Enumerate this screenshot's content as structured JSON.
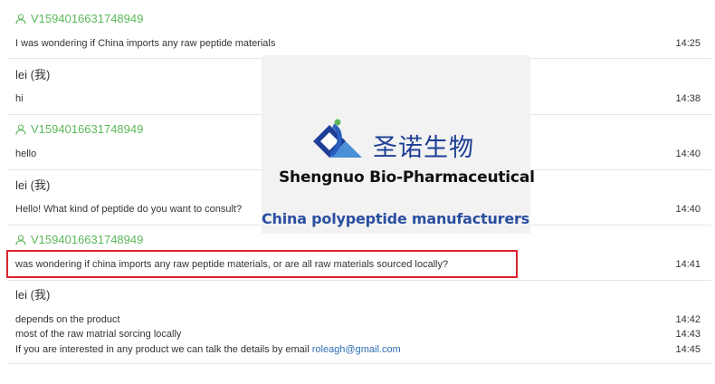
{
  "messages": [
    {
      "sender": "V1594016631748949",
      "sender_type": "visitor",
      "text": "I was wondering if China imports any raw peptide materials",
      "time": "14:25"
    },
    {
      "sender": "lei (我)",
      "sender_type": "staff",
      "text": "hi",
      "time": "14:38"
    },
    {
      "sender": "V1594016631748949",
      "sender_type": "visitor",
      "text": "hello",
      "time": "14:40"
    },
    {
      "sender": "lei (我)",
      "sender_type": "staff",
      "text": "Hello! What kind of peptide do you want to consult?",
      "time": "14:40"
    },
    {
      "sender": "V1594016631748949",
      "sender_type": "visitor",
      "text": "was wondering if china imports any raw peptide materials, or are all raw materials sourced locally?",
      "time": "14:41",
      "highlighted": true
    },
    {
      "sender": "lei (我)",
      "sender_type": "staff",
      "lines": [
        {
          "text": "depends on the product",
          "time": "14:42"
        },
        {
          "text": "most of the raw matrial sorcing locally",
          "time": "14:43"
        },
        {
          "text": "If you are interested in any product we can talk the details by email ",
          "email": "roleagh@gmail.com",
          "time": "14:45"
        }
      ]
    }
  ],
  "overlay": {
    "brand_cn": "圣诺生物",
    "brand_en": "Shengnuo Bio-Pharmaceutical",
    "tagline": "China polypeptide manufacturers"
  },
  "colors": {
    "visitor_name": "#5cb85c",
    "highlight_border": "#d9232d",
    "email_link": "#2f6fb5",
    "brand_blue": "#1f3f96"
  },
  "icons": {
    "visitor": "user-icon"
  }
}
